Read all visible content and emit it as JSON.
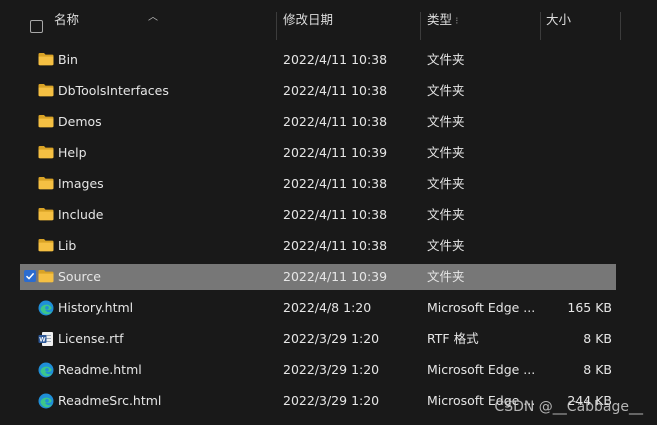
{
  "header": {
    "name_label": "名称",
    "date_label": "修改日期",
    "type_label": "类型",
    "size_label": "大小"
  },
  "files": [
    {
      "name": "Bin",
      "date": "2022/4/11 10:38",
      "type": "文件夹",
      "size": "",
      "icon": "folder-icon",
      "selected": false
    },
    {
      "name": "DbToolsInterfaces",
      "date": "2022/4/11 10:38",
      "type": "文件夹",
      "size": "",
      "icon": "folder-icon",
      "selected": false
    },
    {
      "name": "Demos",
      "date": "2022/4/11 10:38",
      "type": "文件夹",
      "size": "",
      "icon": "folder-icon",
      "selected": false
    },
    {
      "name": "Help",
      "date": "2022/4/11 10:39",
      "type": "文件夹",
      "size": "",
      "icon": "folder-icon",
      "selected": false
    },
    {
      "name": "Images",
      "date": "2022/4/11 10:38",
      "type": "文件夹",
      "size": "",
      "icon": "folder-icon",
      "selected": false
    },
    {
      "name": "Include",
      "date": "2022/4/11 10:38",
      "type": "文件夹",
      "size": "",
      "icon": "folder-icon",
      "selected": false
    },
    {
      "name": "Lib",
      "date": "2022/4/11 10:38",
      "type": "文件夹",
      "size": "",
      "icon": "folder-icon",
      "selected": false
    },
    {
      "name": "Source",
      "date": "2022/4/11 10:39",
      "type": "文件夹",
      "size": "",
      "icon": "folder-icon",
      "selected": true
    },
    {
      "name": "History.html",
      "date": "2022/4/8 1:20",
      "type": "Microsoft Edge ...",
      "size": "165 KB",
      "icon": "edge-icon",
      "selected": false
    },
    {
      "name": "License.rtf",
      "date": "2022/3/29 1:20",
      "type": "RTF 格式",
      "size": "8 KB",
      "icon": "word-doc-icon",
      "selected": false
    },
    {
      "name": "Readme.html",
      "date": "2022/3/29 1:20",
      "type": "Microsoft Edge ...",
      "size": "8 KB",
      "icon": "edge-icon",
      "selected": false
    },
    {
      "name": "ReadmeSrc.html",
      "date": "2022/3/29 1:20",
      "type": "Microsoft Edge ...",
      "size": "244 KB",
      "icon": "edge-icon",
      "selected": false
    }
  ],
  "watermark": "CSDN @__Cabbage__",
  "colors": {
    "background": "#191919",
    "selected_row": "#777777",
    "checkbox_checked": "#2b6cd0",
    "folder": "#f5c043"
  }
}
